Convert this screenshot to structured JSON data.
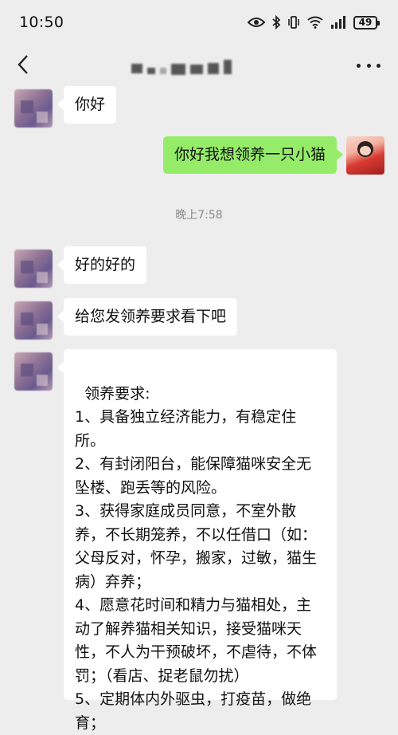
{
  "status_bar": {
    "time": "10:50",
    "battery": "49",
    "icons": [
      "eye-icon",
      "bluetooth-icon",
      "vibrate-icon",
      "wifi-icon",
      "signal-icon",
      "battery-icon"
    ]
  },
  "nav": {
    "back_icon": "chevron-left-icon",
    "more_icon": "more-dots-icon"
  },
  "messages": {
    "m1": {
      "side": "left",
      "text": "你好"
    },
    "m2": {
      "side": "right",
      "text": "你好我想领养一只小猫"
    },
    "time1": "晚上7:58",
    "m3": {
      "side": "left",
      "text": "好的好的"
    },
    "m4": {
      "side": "left",
      "text": "给您发领养要求看下吧"
    },
    "m5": {
      "side": "left",
      "text": "领养要求:\n1、具备独立经济能力，有稳定住所。\n2、有封闭阳台，能保障猫咪安全无坠楼、跑丢等的风险。\n3、获得家庭成员同意，不室外散养，不长期笼养，不以任借口（如：父母反对，怀孕，搬家，过敏，猫生病）弃养；\n4、愿意花时间和精力与猫相处，主动了解养猫相关知识，接受猫咪天性，不人为干预破坏，不虐待，不体罚；（看店、捉老鼠勿扰）\n5、定期体内外驱虫，打疫苗，做绝育；"
    }
  },
  "colors": {
    "background": "#ededed",
    "bubble_left": "#ffffff",
    "bubble_right": "#95ec69",
    "timestamp": "#8a8a8a"
  }
}
